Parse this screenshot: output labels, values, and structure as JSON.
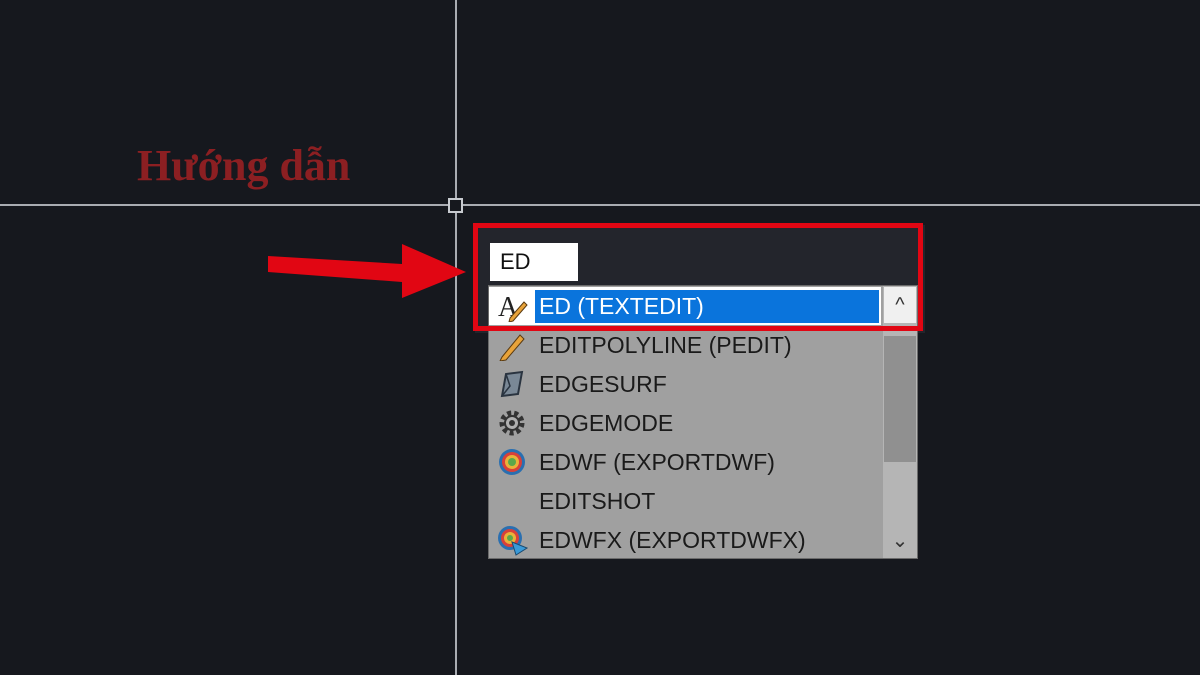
{
  "watermark": "Hướng dẫn",
  "command_input": {
    "value": "ED"
  },
  "autocomplete": {
    "items": [
      {
        "label": "ED (TEXTEDIT)",
        "icon": "text-edit-icon",
        "selected": true
      },
      {
        "label": "EDITPOLYLINE (PEDIT)",
        "icon": "pencil-icon",
        "selected": false
      },
      {
        "label": "EDGESURF",
        "icon": "edge-surface-icon",
        "selected": false
      },
      {
        "label": "EDGEMODE",
        "icon": "gear-icon",
        "selected": false
      },
      {
        "label": "EDWF (EXPORTDWF)",
        "icon": "dwf-export-icon",
        "selected": false
      },
      {
        "label": "EDITSHOT",
        "icon": "",
        "selected": false
      },
      {
        "label": "EDWFX (EXPORTDWFX)",
        "icon": "dwfx-export-icon",
        "selected": false
      }
    ],
    "scroll_up": "^",
    "scroll_down": "⌄"
  },
  "colors": {
    "background": "#16181e",
    "highlight_box": "#e10613",
    "selection": "#0a74dc",
    "arrow": "#e10613",
    "watermark": "#8c1f22"
  }
}
